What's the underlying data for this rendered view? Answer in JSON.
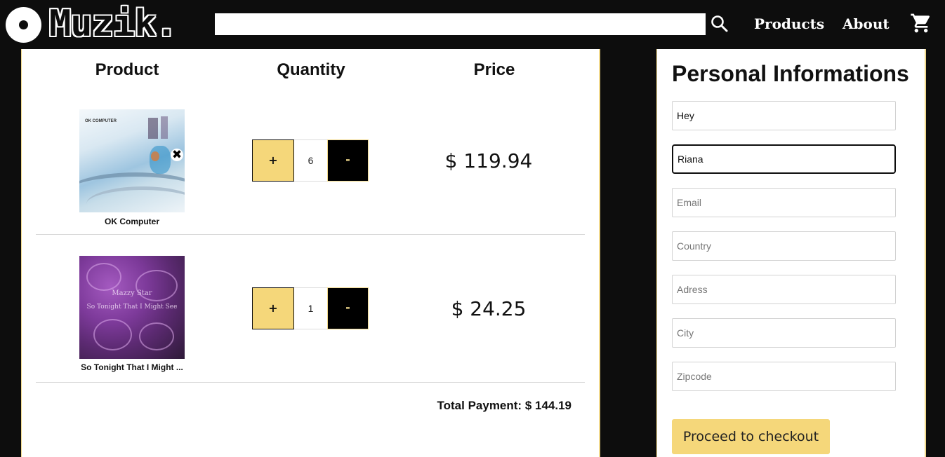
{
  "header": {
    "logo_text": "Muzik.",
    "search": {
      "value": "",
      "placeholder": ""
    },
    "nav": {
      "products": "Products",
      "about": "About"
    }
  },
  "cart": {
    "columns": {
      "product": "Product",
      "quantity": "Quantity",
      "price": "Price"
    },
    "items": [
      {
        "name": "OK Computer",
        "quantity": "6",
        "price": "$ 119.94",
        "plus": "+",
        "minus": "-",
        "cover_title": "OK COMPUTER"
      },
      {
        "name": "So Tonight That I Might ...",
        "quantity": "1",
        "price": "$ 24.25",
        "plus": "+",
        "minus": "-",
        "cover_band": "Mazzy Star",
        "cover_title": "So Tonight That I Might See"
      }
    ],
    "total": "Total Payment: $ 144.19"
  },
  "form": {
    "title": "Personal Informations",
    "fields": [
      {
        "value": "Hey",
        "placeholder": ""
      },
      {
        "value": "Riana",
        "placeholder": ""
      },
      {
        "value": "",
        "placeholder": "Email"
      },
      {
        "value": "",
        "placeholder": "Country"
      },
      {
        "value": "",
        "placeholder": "Adress"
      },
      {
        "value": "",
        "placeholder": "City"
      },
      {
        "value": "",
        "placeholder": "Zipcode"
      }
    ],
    "checkout_label": "Proceed to checkout"
  },
  "colors": {
    "accent": "#f5d77a",
    "background": "#0d0d0d",
    "panel": "#ffffff",
    "border_accent": "#f1d98c"
  },
  "icons": {
    "logo": "vinyl-disc-icon",
    "search": "search-icon",
    "cart": "shopping-cart-icon",
    "remove": "close-icon"
  }
}
